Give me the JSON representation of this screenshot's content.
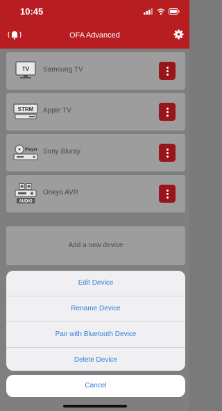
{
  "status": {
    "time": "10:45"
  },
  "nav": {
    "title": "OFA Advanced",
    "left_icon": "bell-icon",
    "right_icon": "gear-icon"
  },
  "devices": [
    {
      "name": "Samsung TV",
      "icon": "tv-icon",
      "icon_text": "TV"
    },
    {
      "name": "Apple TV",
      "icon": "streamer-icon",
      "icon_text": "STRM"
    },
    {
      "name": "Sony Bluray",
      "icon": "player-icon",
      "icon_text": "Player"
    },
    {
      "name": "Onkyo AVR",
      "icon": "audio-receiver-icon",
      "icon_text": "AUDIO"
    }
  ],
  "add_device": "Add a new device",
  "action_sheet": {
    "actions": [
      "Edit Device",
      "Rename Device",
      "Pair with Bluetooth Device",
      "Delete Device"
    ],
    "cancel": "Cancel"
  },
  "colors": {
    "accent": "#b81d22",
    "button": "#9a1519",
    "link": "#2f7fdc"
  }
}
